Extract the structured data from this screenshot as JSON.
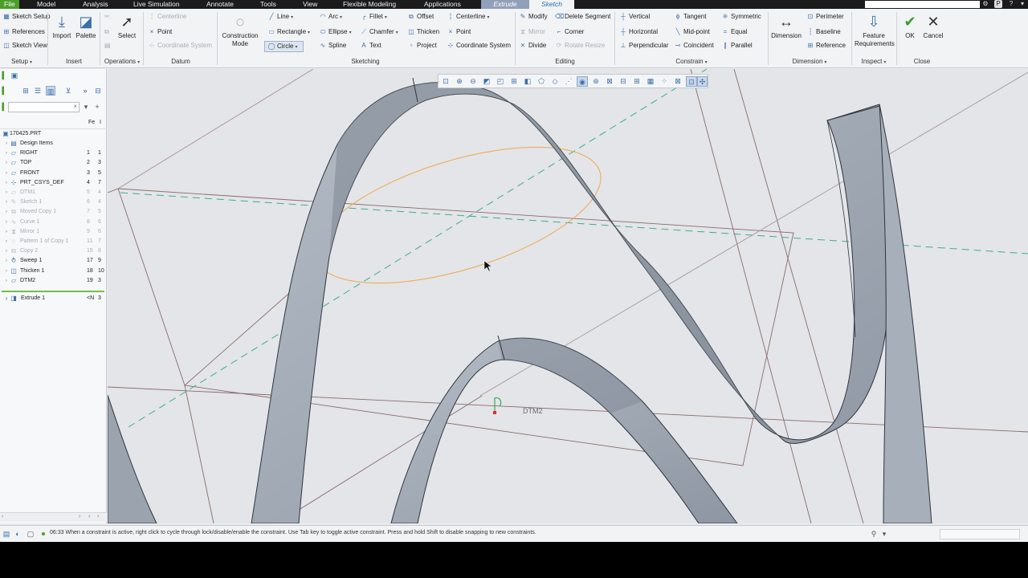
{
  "menubar": {
    "tabs": [
      "File",
      "Model",
      "Analysis",
      "Live Simulation",
      "Annotate",
      "Tools",
      "View",
      "Flexible Modeling",
      "Applications"
    ],
    "contextual_tabs": [
      "Extrude",
      "Sketch"
    ]
  },
  "ribbon": {
    "setup": {
      "items": [
        "Sketch Setup",
        "References",
        "Sketch View"
      ],
      "group_label": "Setup"
    },
    "insert": {
      "import": "Import",
      "palette": "Palette",
      "group_label": "Insert"
    },
    "operations": {
      "select": "Select",
      "group_label": "Operations"
    },
    "datum": {
      "items": [
        "Centerline",
        "Point",
        "Coordinate System"
      ],
      "group_label": "Datum"
    },
    "construction_mode": "Construction Mode",
    "sketching": {
      "col1": [
        "Line",
        "Rectangle",
        "Circle"
      ],
      "col2": [
        "Arc",
        "Ellipse",
        "Spline"
      ],
      "col3": [
        "Fillet",
        "Chamfer",
        "Text"
      ],
      "col4": [
        "Offset",
        "Thicken",
        "Project"
      ],
      "col5": [
        "Centerline",
        "Point",
        "Coordinate System"
      ],
      "group_label": "Sketching"
    },
    "editing": {
      "col1": [
        "Modify",
        "Mirror",
        "Divide"
      ],
      "col2": [
        "Delete Segment",
        "Corner",
        "Rotate Resize"
      ],
      "group_label": "Editing"
    },
    "constrain": {
      "col1": [
        "Vertical",
        "Horizontal",
        "Perpendicular"
      ],
      "col2": [
        "Tangent",
        "Mid-point",
        "Coincident"
      ],
      "col3": [
        "Symmetric",
        "Equal",
        "Parallel"
      ],
      "group_label": "Constrain"
    },
    "dimension": {
      "main": "Dimension",
      "items": [
        "Perimeter",
        "Baseline",
        "Reference"
      ],
      "group_label": "Dimension"
    },
    "inspect": {
      "main": "Feature Requirements",
      "group_label": "Inspect"
    },
    "close": {
      "ok": "OK",
      "cancel": "Cancel",
      "group_label": "Close"
    }
  },
  "tree": {
    "header_cols": [
      "Fe",
      "I"
    ],
    "root": "170425.PRT",
    "items": [
      {
        "label": "Design Items",
        "c1": "",
        "c2": "",
        "icon": "folder-icon",
        "dim": false
      },
      {
        "label": "RIGHT",
        "c1": "1",
        "c2": "1",
        "icon": "datum-plane-icon",
        "dim": false
      },
      {
        "label": "TOP",
        "c1": "2",
        "c2": "3",
        "icon": "datum-plane-icon",
        "dim": false
      },
      {
        "label": "FRONT",
        "c1": "3",
        "c2": "5",
        "icon": "datum-plane-icon",
        "dim": false
      },
      {
        "label": "PRT_CSYS_DEF",
        "c1": "4",
        "c2": "7",
        "icon": "csys-icon",
        "dim": false
      },
      {
        "label": "DTM1",
        "c1": "5",
        "c2": "4",
        "icon": "datum-plane-icon",
        "dim": true
      },
      {
        "label": "Sketch 1",
        "c1": "6",
        "c2": "4",
        "icon": "sketch-icon",
        "dim": true
      },
      {
        "label": "Moved Copy 1",
        "c1": "7",
        "c2": "5",
        "icon": "copy-icon",
        "dim": true
      },
      {
        "label": "Curve 1",
        "c1": "8",
        "c2": "6",
        "icon": "curve-icon",
        "dim": true
      },
      {
        "label": "Mirror 1",
        "c1": "9",
        "c2": "6",
        "icon": "mirror-icon",
        "dim": true
      },
      {
        "label": "Pattern 1 of Copy 1",
        "c1": "11",
        "c2": "7",
        "icon": "pattern-icon",
        "dim": true
      },
      {
        "label": "Copy 2",
        "c1": "15",
        "c2": "8",
        "icon": "copy-icon",
        "dim": true
      },
      {
        "label": "Sweep 1",
        "c1": "17",
        "c2": "9",
        "icon": "sweep-icon",
        "dim": false
      },
      {
        "label": "Thicken 1",
        "c1": "18",
        "c2": "10",
        "icon": "thicken-icon",
        "dim": false
      },
      {
        "label": "DTM2",
        "c1": "19",
        "c2": "3",
        "icon": "datum-plane-icon",
        "dim": false
      }
    ],
    "active": {
      "label": "Extrude 1",
      "c1": "<N",
      "c2": "3"
    }
  },
  "viewport": {
    "datum_label": "DTM2",
    "colors": {
      "background": "#e3e5e8",
      "ribbon_face": "#9fa8b3",
      "ribbon_edge": "#2f353c",
      "sketch_circle": "#f0a84a",
      "datum_axis": "#3fae8a",
      "datum_plane": "#8c6b6b"
    }
  },
  "statusbar": {
    "message": "06:33 When a constraint is active, right click to cycle through lock/disable/enable the constraint. Use Tab key to toggle active constraint. Press and hold Shift to disable snapping to new constraints."
  }
}
